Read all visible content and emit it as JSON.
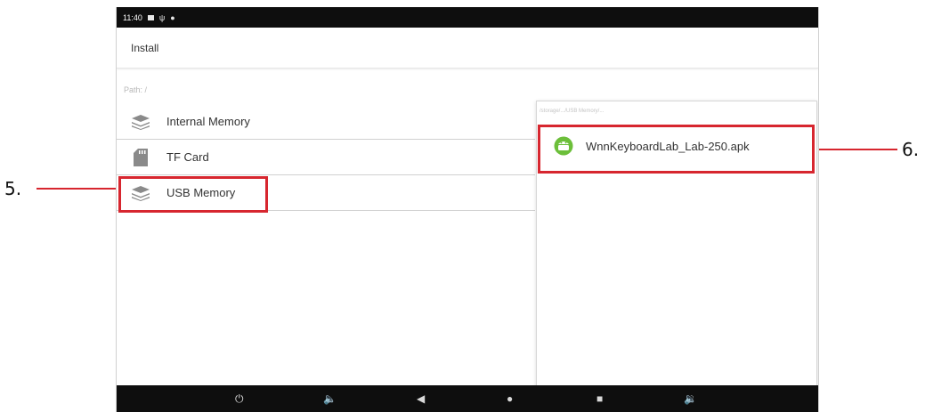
{
  "statusbar": {
    "time": "11:40"
  },
  "window": {
    "title": "Install"
  },
  "path": {
    "text": "Path:  /"
  },
  "storage_items": [
    {
      "label": "Internal Memory",
      "icon": "stack-icon"
    },
    {
      "label": "TF Card",
      "icon": "sd-card-icon"
    },
    {
      "label": "USB Memory",
      "icon": "stack-icon"
    }
  ],
  "file_panel": {
    "header": "/storage/.../USB Memory/...",
    "files": [
      {
        "name": "WnnKeyboardLab_Lab-250.apk",
        "icon": "android-icon"
      }
    ]
  },
  "annotations": {
    "left_label": "5.",
    "right_label": "6."
  },
  "colors": {
    "annotation": "#d7262f",
    "bars": "#0e0e0e",
    "apk_green": "#6cbf3a"
  }
}
